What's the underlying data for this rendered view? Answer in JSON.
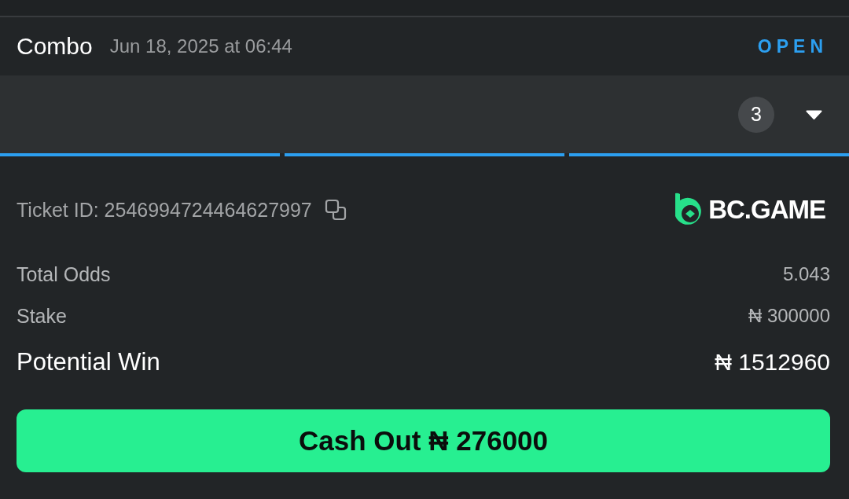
{
  "header": {
    "title": "Combo",
    "date": "Jun 18, 2025 at 06:44",
    "status": {
      "label": "OPEN",
      "kind": "open"
    }
  },
  "selections": {
    "count": "3",
    "expanded": false
  },
  "progress": [
    {
      "done": true
    },
    {
      "done": true
    },
    {
      "done": true
    }
  ],
  "ticket": {
    "label": "Ticket ID: 2546994724464627997",
    "brand": "BC.GAME"
  },
  "summary": [
    {
      "label": "Total Odds",
      "value": "5.043",
      "kind": "regular"
    },
    {
      "label": "Stake",
      "value": "₦ 300000",
      "kind": "regular"
    },
    {
      "label": "Potential Win",
      "value": "₦ 1512960",
      "kind": "emphasis"
    }
  ],
  "cash_out": {
    "label": "Cash Out ₦ 276000"
  }
}
